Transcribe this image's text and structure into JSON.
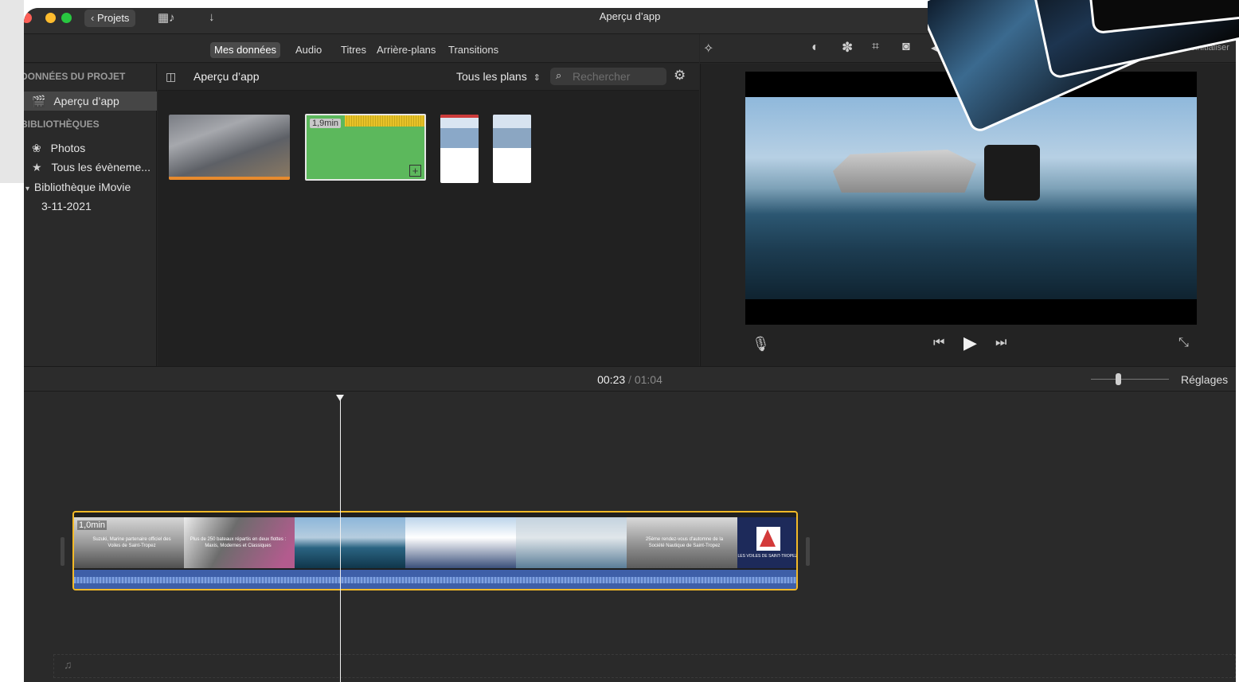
{
  "titlebar": {
    "projects_button": "Projets",
    "title": "Aperçu d’app"
  },
  "tabs": [
    {
      "label": "Mes données",
      "active": true
    },
    {
      "label": "Audio",
      "active": false
    },
    {
      "label": "Titres",
      "active": false
    },
    {
      "label": "Arrière-plans",
      "active": false
    },
    {
      "label": "Transitions",
      "active": false
    }
  ],
  "sidebar": {
    "project_header": "DONNÉES DU PROJET",
    "project_item": "Aperçu d’app",
    "libraries_header": "BIBLIOTHÈQUES",
    "items": [
      "Photos",
      "Tous les évèneme...",
      "Bibliothèque iMovie",
      "3-11-2021"
    ]
  },
  "browser": {
    "title": "Aperçu d’app",
    "filter": "Tous les plans",
    "search_placeholder": "Rechercher",
    "clip_duration": "1,9min"
  },
  "viewer": {
    "reset_label": "Réinitialiser"
  },
  "timebar": {
    "current_time": "00:23",
    "separator": "/",
    "total_time": "01:04",
    "settings_label": "Réglages"
  },
  "timeline": {
    "clip_duration": "1,0min",
    "caption1": "Suzuki, Marine partenaire officiel des Voiles de Saint-Tropez",
    "caption2": "Plus de 250 bateaux répartis en deux flottes : Maxis, Modernes et Classiques",
    "caption3": "25ème rendez-vous d'automne de la Société Nautique de Saint-Tropez",
    "end_logo": "LES VOILES DE SAINT-TROPEZ"
  },
  "colors": {
    "accent_yellow": "#f3b927",
    "audio_blue": "#3e5fa8",
    "green_clip": "#5cb85c",
    "orange_bar": "#e88b2e"
  }
}
